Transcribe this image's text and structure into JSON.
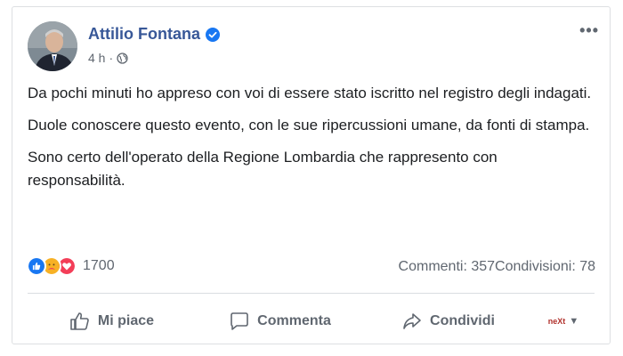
{
  "post": {
    "author": "Attilio Fontana",
    "time": "4 h",
    "separator": "·",
    "paragraphs": [
      "Da pochi minuti ho appreso con voi di essere stato iscritto nel registro degli indagati.",
      "Duole conoscere questo evento, con le sue ripercussioni umane, da fonti di stampa.",
      "Sono certo dell'operato della Regione Lombardia che rappresento con responsabilità."
    ],
    "more_icon": "more-dots-icon"
  },
  "stats": {
    "reaction_count": "1700",
    "comments": "Commenti: 357",
    "shares": "Condivisioni: 78",
    "reaction_icons": [
      "like-reaction-icon",
      "care-reaction-icon",
      "love-reaction-icon"
    ]
  },
  "actions": {
    "like": "Mi piace",
    "comment": "Commenta",
    "share": "Condividi",
    "page_logo_text": "neXt"
  },
  "colors": {
    "author": "#385898",
    "muted": "#606770",
    "like_blue": "#1877f2",
    "love_red": "#f33e58"
  }
}
